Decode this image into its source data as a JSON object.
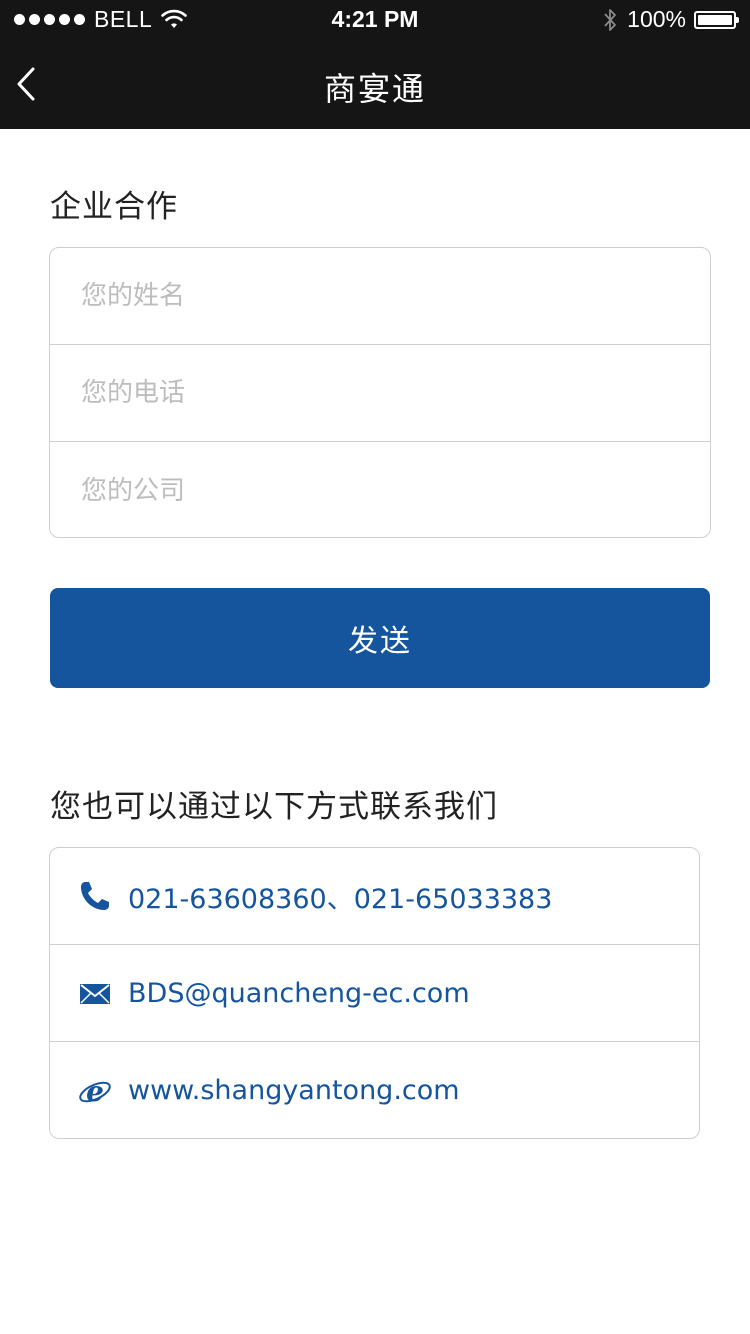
{
  "status_bar": {
    "carrier": "BELL",
    "time": "4:21 PM",
    "battery": "100%"
  },
  "nav": {
    "title": "商宴通"
  },
  "form": {
    "section_title": "企业合作",
    "fields": [
      {
        "placeholder": "您的姓名"
      },
      {
        "placeholder": "您的电话"
      },
      {
        "placeholder": "您的公司"
      }
    ],
    "send_label": "发送"
  },
  "contact": {
    "section_title": "您也可以通过以下方式联系我们",
    "phone": "021-63608360、021-65033383",
    "email": "BDS@quancheng-ec.com",
    "website": "www.shangyantong.com"
  },
  "colors": {
    "accent": "#15559e",
    "bar_bg": "#151515",
    "border": "#cfcfcf",
    "placeholder": "#bdbdbd"
  },
  "icons": [
    "wifi-icon",
    "bluetooth-icon",
    "battery-icon",
    "back-chevron-icon",
    "phone-icon",
    "mail-icon",
    "ie-browser-icon"
  ]
}
